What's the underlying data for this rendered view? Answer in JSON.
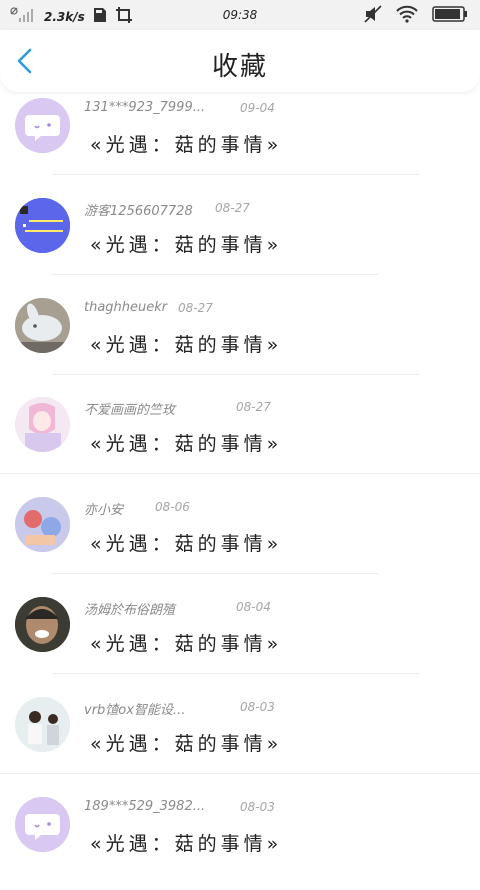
{
  "status_bar": {
    "net_speed": "2.3k/s",
    "time": "09:38"
  },
  "header": {
    "title": "收藏"
  },
  "favorites": [
    {
      "user": "131***923_7999...",
      "date": "09-04",
      "title": "«光遇：菇的事情»",
      "avatar": "default-avatar"
    },
    {
      "user": "游客1256607728",
      "date": "08-27",
      "title": "«光遇：菇的事情»",
      "avatar": "blue-text-avatar"
    },
    {
      "user": "thaghheuekr",
      "date": "08-27",
      "title": "«光遇：菇的事情»",
      "avatar": "rabbit-avatar"
    },
    {
      "user": "不爱画画的竺玫",
      "date": "08-27",
      "title": "«光遇：菇的事情»",
      "avatar": "anime-pink-avatar"
    },
    {
      "user": "亦小安",
      "date": "08-06",
      "title": "«光遇：菇的事情»",
      "avatar": "illustration-avatar"
    },
    {
      "user": "汤姆於布俗朗殖",
      "date": "08-04",
      "title": "«光遇：菇的事情»",
      "avatar": "man-avatar"
    },
    {
      "user": "vrb馇ox智能设...",
      "date": "08-03",
      "title": "«光遇：菇的事情»",
      "avatar": "photo-avatar"
    },
    {
      "user": "189***529_3982...",
      "date": "08-03",
      "title": "«光遇：菇的事情»",
      "avatar": "default-avatar"
    }
  ]
}
